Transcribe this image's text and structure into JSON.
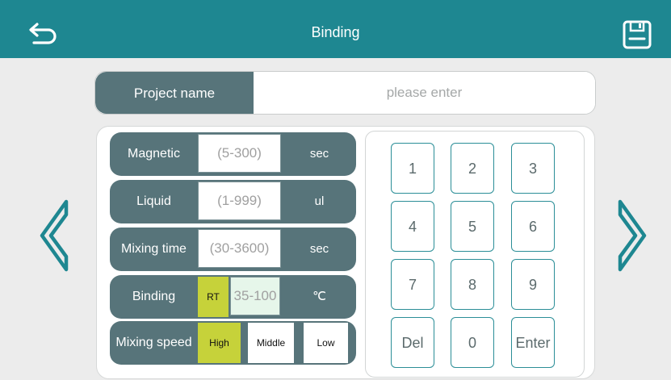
{
  "header": {
    "title": "Binding",
    "back_icon": "back-arrow-icon",
    "save_icon": "floppy-save-icon",
    "bar_color": "#1e8791"
  },
  "project": {
    "label": "Project name",
    "placeholder": "please enter"
  },
  "params": {
    "magnetic": {
      "label": "Magnetic",
      "placeholder": "(5-300)",
      "unit": "sec"
    },
    "liquid": {
      "label": "Liquid",
      "placeholder": "(1-999)",
      "unit": "ul"
    },
    "mixing_time": {
      "label": "Mixing time",
      "placeholder": "(30-3600)",
      "unit": "sec"
    },
    "binding": {
      "label": "Binding",
      "rt_label": "RT",
      "placeholder": "35-100",
      "unit": "℃"
    },
    "mixing_speed": {
      "label": "Mixing speed",
      "options": [
        "High",
        "Middle",
        "Low"
      ],
      "selected": "High"
    }
  },
  "keypad": {
    "keys": [
      "1",
      "2",
      "3",
      "4",
      "5",
      "6",
      "7",
      "8",
      "9",
      "Del",
      "0",
      "Enter"
    ]
  },
  "nav": {
    "prev_icon": "chevron-left-icon",
    "next_icon": "chevron-right-icon"
  },
  "colors": {
    "accent": "#1e8791",
    "row_bg": "#57747a",
    "highlight": "#c6d23a"
  }
}
